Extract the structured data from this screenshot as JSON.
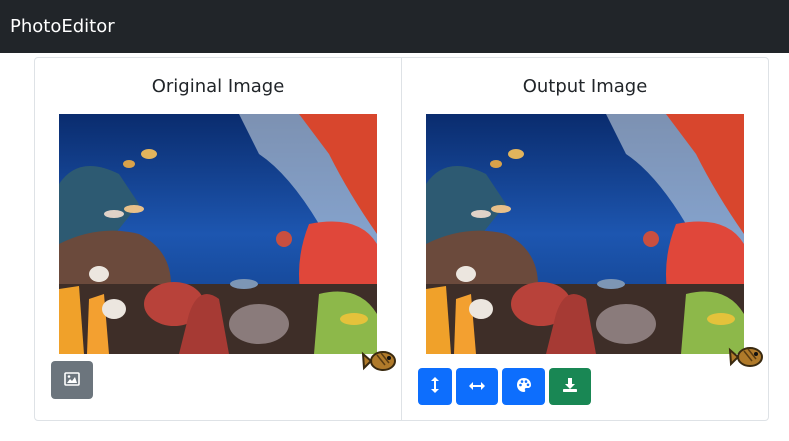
{
  "navbar": {
    "brand": "PhotoEditor"
  },
  "panels": {
    "original": {
      "title": "Original Image"
    },
    "output": {
      "title": "Output Image"
    }
  },
  "buttons": {
    "upload": {
      "icon": "image-icon",
      "color": "#6c757d"
    },
    "flip_vertical": {
      "icon": "arrows-vertical-icon",
      "color": "#0d6efd"
    },
    "flip_horizontal": {
      "icon": "arrows-horizontal-icon",
      "color": "#0d6efd"
    },
    "color_filter": {
      "icon": "palette-icon",
      "color": "#0d6efd"
    },
    "download": {
      "icon": "download-icon",
      "color": "#198754"
    }
  }
}
